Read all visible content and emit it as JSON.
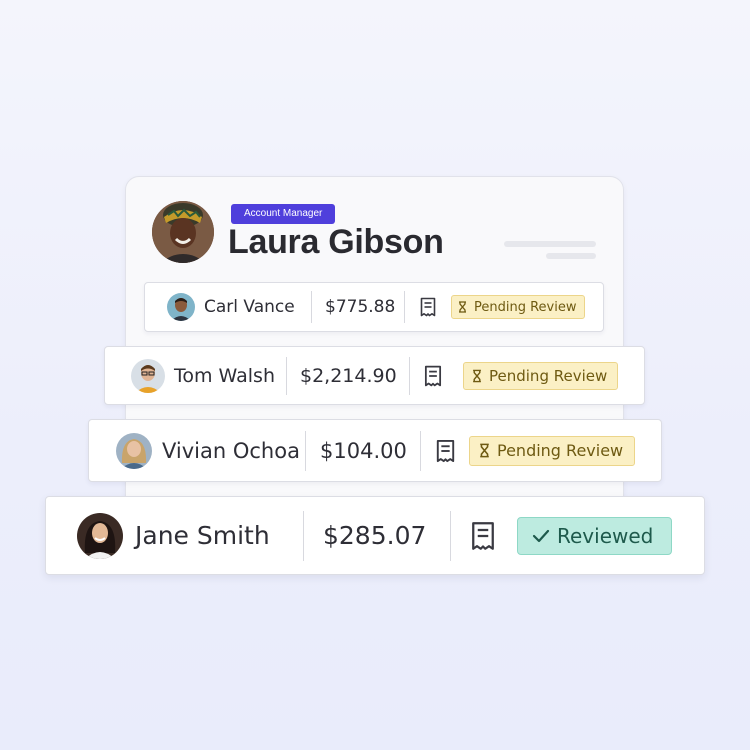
{
  "colors": {
    "background": "#eef0fb",
    "role_badge": "#4f3fdc",
    "pending_bg": "#fbf0c5",
    "pending_text": "#6e5a12",
    "reviewed_bg": "#bdebe0",
    "reviewed_text": "#1e5a4c"
  },
  "profile": {
    "role": "Account Manager",
    "name": "Laura Gibson",
    "avatar_icon": "person-avatar"
  },
  "rows": [
    {
      "name": "Carl Vance",
      "amount": "$775.88",
      "receipt_icon": "receipt-icon",
      "status_icon": "hourglass-icon",
      "status": "Pending Review"
    },
    {
      "name": "Tom Walsh",
      "amount": "$2,214.90",
      "receipt_icon": "receipt-icon",
      "status_icon": "hourglass-icon",
      "status": "Pending Review"
    },
    {
      "name": "Vivian Ochoa",
      "amount": "$104.00",
      "receipt_icon": "receipt-icon",
      "status_icon": "hourglass-icon",
      "status": "Pending Review"
    },
    {
      "name": "Jane Smith",
      "amount": "$285.07",
      "receipt_icon": "receipt-icon",
      "status_icon": "check-icon",
      "status": "Reviewed"
    }
  ]
}
